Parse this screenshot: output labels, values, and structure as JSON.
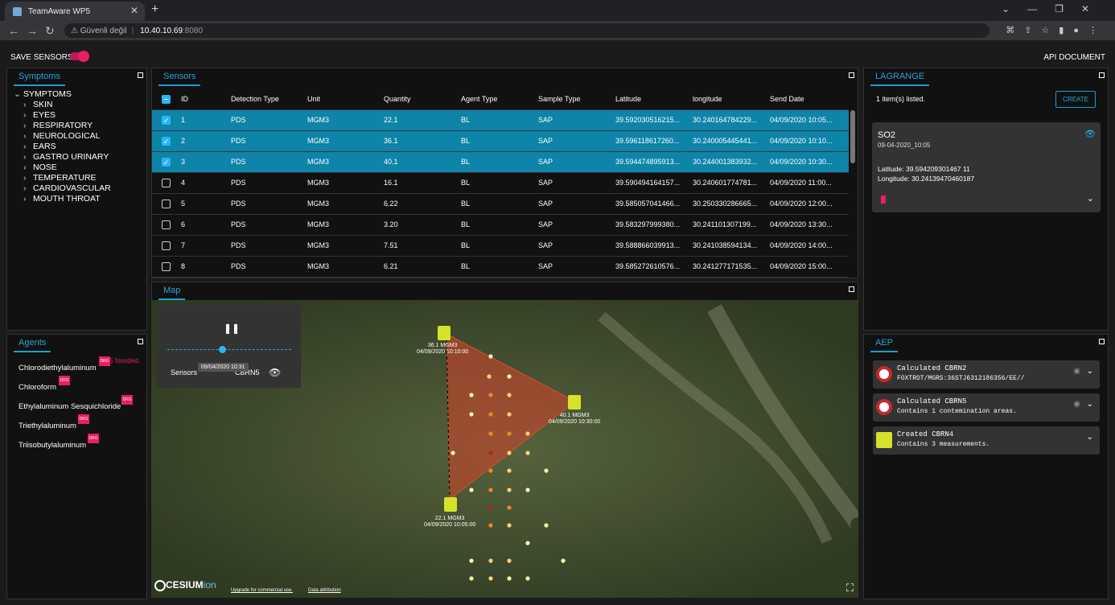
{
  "browser": {
    "tab_title": "TeamAware WP5",
    "security": "Güvenli değil",
    "host": "10.40.10.69",
    "port": ":8080"
  },
  "header": {
    "save_sensors": "SAVE SENSORS",
    "api_document": "API DOCUMENT"
  },
  "symptoms": {
    "title": "Symptoms",
    "root": "SYMPTOMS",
    "items": [
      "SKIN",
      "EYES",
      "RESPIRATORY",
      "NEUROLOGICAL",
      "EARS",
      "GASTRO URINARY",
      "NOSE",
      "TEMPERATURE",
      "CARDIOVASCULAR",
      "MOUTH THROAT"
    ]
  },
  "agents": {
    "title": "Agents",
    "found": "5 founded.",
    "tag": "DRG",
    "items": [
      "Chlorodiethylaluminum",
      "Chloroform",
      "Ethylaluminum Sesquichloride",
      "Triethylaluminum",
      "Triisobutylaluminum"
    ]
  },
  "sensors": {
    "title": "Sensors",
    "columns": [
      "ID",
      "Detection Type",
      "Unit",
      "Quantity",
      "Agent Type",
      "Sample Type",
      "Latitude",
      "longitude",
      "Send Date"
    ],
    "rows": [
      [
        "1",
        "PDS",
        "MGM3",
        "22.1",
        "BL",
        "SAP",
        "39.592030516215...",
        "30.240164784229...",
        "04/09/2020 10:05..."
      ],
      [
        "2",
        "PDS",
        "MGM3",
        "36.1",
        "BL",
        "SAP",
        "39.596118617260...",
        "30.240005445441...",
        "04/09/2020 10:10..."
      ],
      [
        "3",
        "PDS",
        "MGM3",
        "40.1",
        "BL",
        "SAP",
        "39.594474895913...",
        "30.244001383932...",
        "04/09/2020 10:30..."
      ],
      [
        "4",
        "PDS",
        "MGM3",
        "16.1",
        "BL",
        "SAP",
        "39.590494164157...",
        "30.240601774781...",
        "04/09/2020 11:00..."
      ],
      [
        "5",
        "PDS",
        "MGM3",
        "6.22",
        "BL",
        "SAP",
        "39.585057041466...",
        "30.250330286665...",
        "04/09/2020 12:00..."
      ],
      [
        "6",
        "PDS",
        "MGM3",
        "3.20",
        "BL",
        "SAP",
        "39.583297999380...",
        "30.241101307199...",
        "04/09/2020 13:30..."
      ],
      [
        "7",
        "PDS",
        "MGM3",
        "7.51",
        "BL",
        "SAP",
        "39.588866039913...",
        "30.241038594134...",
        "04/09/2020 14:00..."
      ],
      [
        "8",
        "PDS",
        "MGM3",
        "6.21",
        "BL",
        "SAP",
        "39.585272610576...",
        "30.241277171535...",
        "04/09/2020 15:00..."
      ]
    ],
    "selected": [
      true,
      true,
      true,
      false,
      false,
      false,
      false,
      false
    ]
  },
  "map": {
    "title": "Map",
    "player_label": "Sensors",
    "layer": "CBRN5",
    "tooltip": "09/04/2020 10:31",
    "slider": 0.44,
    "markers": [
      {
        "label": "36.1 MGM3",
        "date": "04/09/2020 10:10:00"
      },
      {
        "label": "40.1 MGM3",
        "date": "04/09/2020 10:30:00"
      },
      {
        "label": "22.1 MGM3",
        "date": "04/09/2020 10:05:00"
      }
    ],
    "logo": "CESIUM",
    "logo_sub": "ion",
    "upgrade": "Upgrade for commercial use.",
    "attribution": "Data attribution"
  },
  "lagrange": {
    "title": "LAGRANGE",
    "listed": "1 item(s) listed.",
    "create": "CREATE",
    "card": {
      "name": "SO2",
      "date": "09-04-2020_10:05",
      "lat": "Latitude: 39.594209301467 11",
      "lon": "Longitude: 30.24139470460187"
    }
  },
  "aep": {
    "title": "AEP",
    "items": [
      {
        "title": "Calculated CBRN2",
        "sub": "FOXTROT/MGRS:36STJ6312186356/EE//"
      },
      {
        "title": "Calculated CBRN5",
        "sub": "Contains 1 contemination areas."
      },
      {
        "title": "Created CBRN4",
        "sub": "Contains 3 measurements."
      }
    ]
  }
}
